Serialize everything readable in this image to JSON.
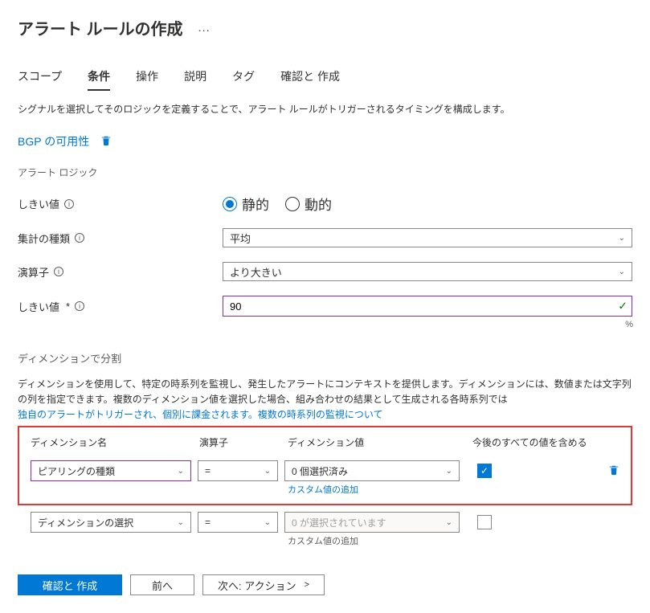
{
  "header": {
    "title": "アラート ルールの作成",
    "more": "…"
  },
  "tabs": {
    "scope": "スコープ",
    "condition": "条件",
    "action": "操作",
    "details": "説明",
    "tags": "タグ",
    "review": "確認と 作成"
  },
  "desc": "シグナルを選択してそのロジックを定義することで、アラート ルールがトリガーされるタイミングを構成します。",
  "signal": {
    "name": "BGP の可用性"
  },
  "alertLogicLabel": "アラート ロジック",
  "threshold": {
    "label": "しきい値",
    "static": "静的",
    "dynamic": "動的"
  },
  "aggregation": {
    "label": "集計の種類",
    "value": "平均"
  },
  "operator": {
    "label": "演算子",
    "value": "より大きい"
  },
  "thresholdVal": {
    "label": "しきい値",
    "star": "*",
    "value": "90",
    "suffix": "%"
  },
  "split": {
    "title": "ディメンションで分割",
    "desc1": "ディメンションを使用して、特定の時系列を監視し、発生したアラートにコンテキストを提供します。ディメンションには、数値または文字列の列を指定できます。複数のディメンション値を選択した場合、組み合わせの結果として生成される各時系列では",
    "desc2": "独自のアラートがトリガーされ、個別に課金されます。複数の時系列の監視について"
  },
  "dimHeader": {
    "name": "ディメンション名",
    "op": "演算子",
    "val": "ディメンション値",
    "future": "今後のすべての値を含める"
  },
  "dimRow1": {
    "name": "ピアリングの種類",
    "op": "=",
    "val": "0 個選択済み",
    "custom": "カスタム値の追加"
  },
  "dimRow2": {
    "name": "ディメンションの選択",
    "op": "=",
    "val": "0 が選択されています",
    "custom": "カスタム値の追加"
  },
  "footer": {
    "review": "確認と 作成",
    "prev": "前へ",
    "next": "次へ: アクション",
    "arrow": ">"
  }
}
